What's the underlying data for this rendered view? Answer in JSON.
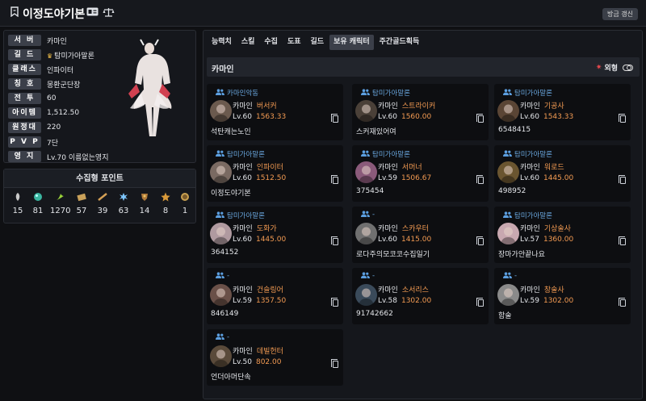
{
  "header": {
    "title": "이정도야기본",
    "refresh_label": "방금 갱신"
  },
  "profile": {
    "rows": [
      {
        "label": "서 버",
        "value": "카마인"
      },
      {
        "label": "길 드",
        "value": "탐미가아말론"
      },
      {
        "label": "클래스",
        "value": "인파이터"
      },
      {
        "label": "칭 호",
        "value": "몽환군단장"
      },
      {
        "label": "전 투",
        "value": "60"
      },
      {
        "label": "아이템",
        "value": "1,512.50"
      },
      {
        "label": "원정대",
        "value": "220"
      },
      {
        "label": "P V P",
        "value": "7단"
      },
      {
        "label": "영 지",
        "value": "Lv.70 이름없는영지"
      }
    ]
  },
  "collect": {
    "title": "수집형 포인트",
    "items": [
      {
        "icon": "mokoko-seed-icon",
        "value": "15"
      },
      {
        "icon": "island-heart-icon",
        "value": "81"
      },
      {
        "icon": "giant-heart-icon",
        "value": "1270"
      },
      {
        "icon": "artwork-icon",
        "value": "57"
      },
      {
        "icon": "voyage-icon",
        "value": "39"
      },
      {
        "icon": "world-tree-leaf-icon",
        "value": "63"
      },
      {
        "icon": "ignea-token-icon",
        "value": "14"
      },
      {
        "icon": "orpheus-star-icon",
        "value": "8"
      },
      {
        "icon": "sea-bounty-icon",
        "value": "1"
      }
    ]
  },
  "tabs": [
    "능력치",
    "스킬",
    "수집",
    "도표",
    "길드",
    "보유 캐릭터",
    "주간골드획득"
  ],
  "active_tab": "보유 캐릭터",
  "subhead": {
    "title": "카마인",
    "appearance_label": "외형"
  },
  "characters": [
    {
      "guild": "카마인악동",
      "server": "카마인",
      "class": "버서커",
      "lv": "Lv.60",
      "item": "1563.33",
      "name": "석탄캐는노인",
      "avatar": "#6b5a4e"
    },
    {
      "guild": "탐미가아말론",
      "server": "카마인",
      "class": "스트라이커",
      "lv": "Lv.60",
      "item": "1560.00",
      "name": "스커재있어여",
      "avatar": "#4a4038"
    },
    {
      "guild": "탐미가아말론",
      "server": "카마인",
      "class": "기공사",
      "lv": "Lv.60",
      "item": "1543.33",
      "name": "6548415",
      "avatar": "#5a4535"
    },
    {
      "guild": "탐미가아말론",
      "server": "카마인",
      "class": "인파이터",
      "lv": "Lv.60",
      "item": "1512.50",
      "name": "이정도야기본",
      "avatar": "#7a6a62"
    },
    {
      "guild": "탐미가아말론",
      "server": "카마인",
      "class": "서머너",
      "lv": "Lv.59",
      "item": "1506.67",
      "name": "375454",
      "avatar": "#8a5a7a"
    },
    {
      "guild": "탐미가아말론",
      "server": "카마인",
      "class": "워로드",
      "lv": "Lv.60",
      "item": "1445.00",
      "name": "498952",
      "avatar": "#6a5530"
    },
    {
      "guild": "탐미가아말론",
      "server": "카마인",
      "class": "도화가",
      "lv": "Lv.60",
      "item": "1445.00",
      "name": "364152",
      "avatar": "#b09aa0"
    },
    {
      "guild": "-",
      "server": "카마인",
      "class": "스카우터",
      "lv": "Lv.60",
      "item": "1415.00",
      "name": "로다주의모코코수집일기",
      "avatar": "#707070"
    },
    {
      "guild": "탐미가아말론",
      "server": "카마인",
      "class": "기상술사",
      "lv": "Lv.57",
      "item": "1360.00",
      "name": "장마가안끝나요",
      "avatar": "#c8a8b0"
    },
    {
      "guild": "-",
      "server": "카마인",
      "class": "건슬링어",
      "lv": "Lv.59",
      "item": "1357.50",
      "name": "846149",
      "avatar": "#6a5048"
    },
    {
      "guild": "-",
      "server": "카마인",
      "class": "소서리스",
      "lv": "Lv.58",
      "item": "1302.00",
      "name": "91742662",
      "avatar": "#3a4a5a"
    },
    {
      "guild": "-",
      "server": "카마인",
      "class": "창술사",
      "lv": "Lv.59",
      "item": "1302.00",
      "name": "함술",
      "avatar": "#8a8a8a"
    },
    {
      "guild": "-",
      "server": "카마인",
      "class": "데빌헌터",
      "lv": "Lv.50",
      "item": "802.00",
      "name": "언더아머단속",
      "avatar": "#5a4a3a"
    }
  ]
}
